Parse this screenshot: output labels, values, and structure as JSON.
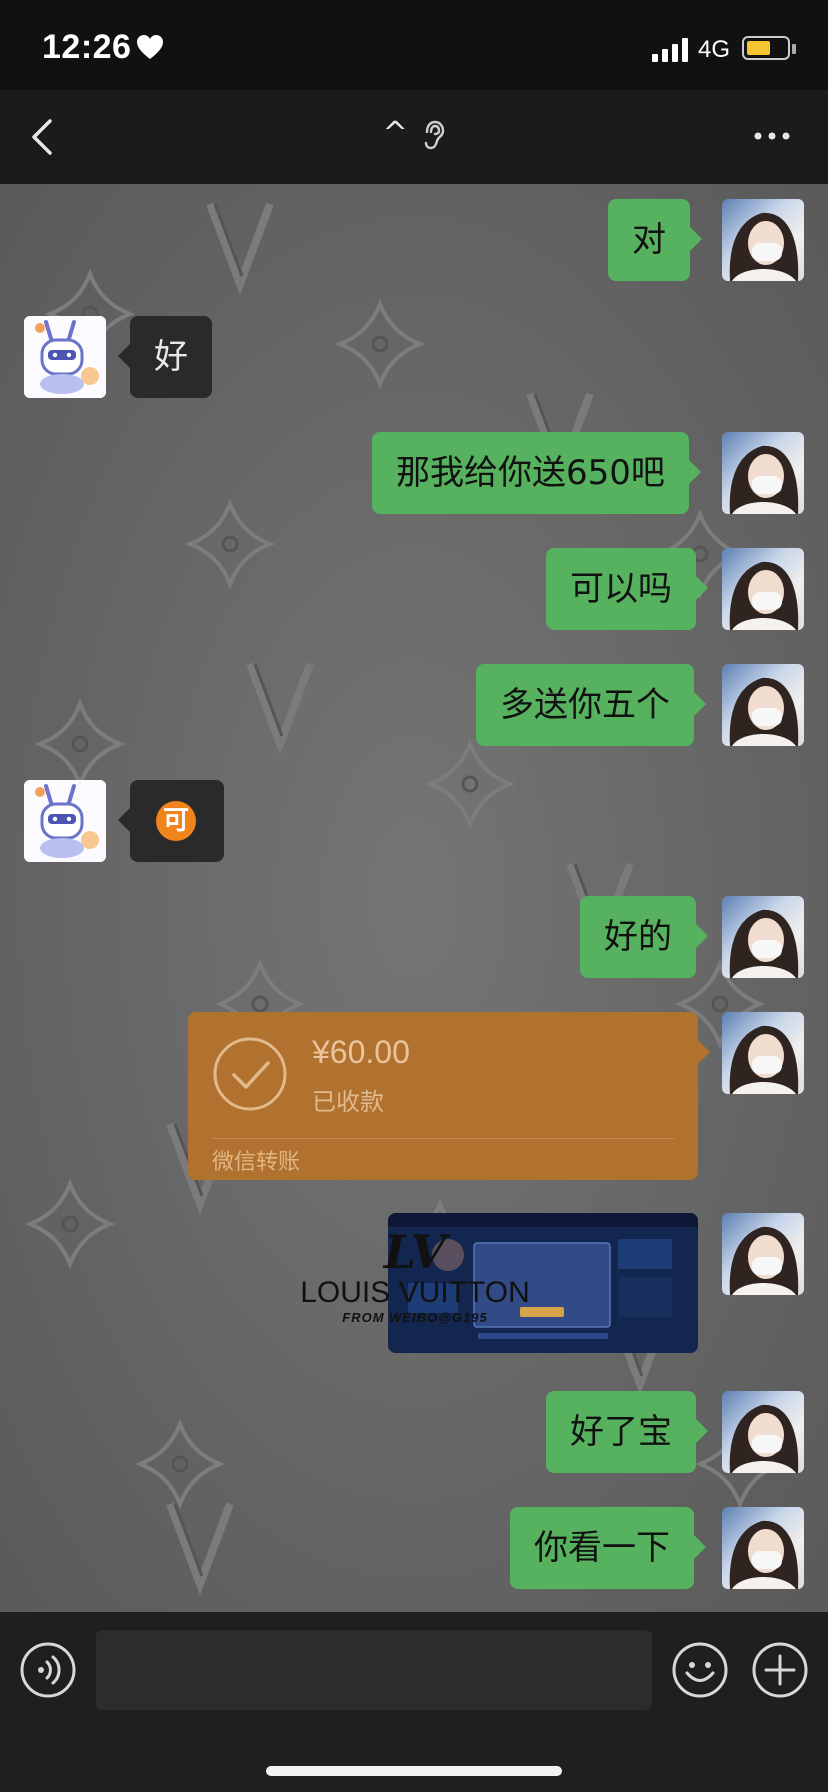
{
  "status_bar": {
    "time": "12:26",
    "network": "4G",
    "battery_level": 0.6,
    "battery_color": "#f7c531"
  },
  "nav": {
    "title": "^",
    "back_icon": "chevron-left-icon",
    "more_icon": "more-dots-icon",
    "title_icon": "ear-icon"
  },
  "colors": {
    "sent_bubble": "#56b25f",
    "received_bubble": "#2a2a2a",
    "transfer_card": "#b0722e",
    "chat_background": "#6a6a6a"
  },
  "messages": [
    {
      "side": "me",
      "text": "对"
    },
    {
      "side": "other",
      "text": "好"
    },
    {
      "side": "me",
      "text": "那我给你送650吧"
    },
    {
      "side": "me",
      "text": "可以吗"
    },
    {
      "side": "me",
      "text": "多送你五个"
    },
    {
      "side": "other",
      "sticker": "可"
    },
    {
      "side": "me",
      "text": "好的"
    },
    {
      "side": "me",
      "transfer": {
        "amount": "¥60.00",
        "status": "已收款",
        "label": "微信转账"
      }
    },
    {
      "side": "me",
      "image": "game-screenshot"
    },
    {
      "side": "me",
      "text": "好了宝"
    },
    {
      "side": "me",
      "text": "你看一下"
    }
  ],
  "watermark": {
    "logo": "LV",
    "brand": "LOUIS VUITTON",
    "from": "FROM WEIBO@G195"
  },
  "input": {
    "value": "",
    "voice_icon": "voice-icon",
    "emoji_icon": "emoji-icon",
    "plus_icon": "plus-icon"
  }
}
